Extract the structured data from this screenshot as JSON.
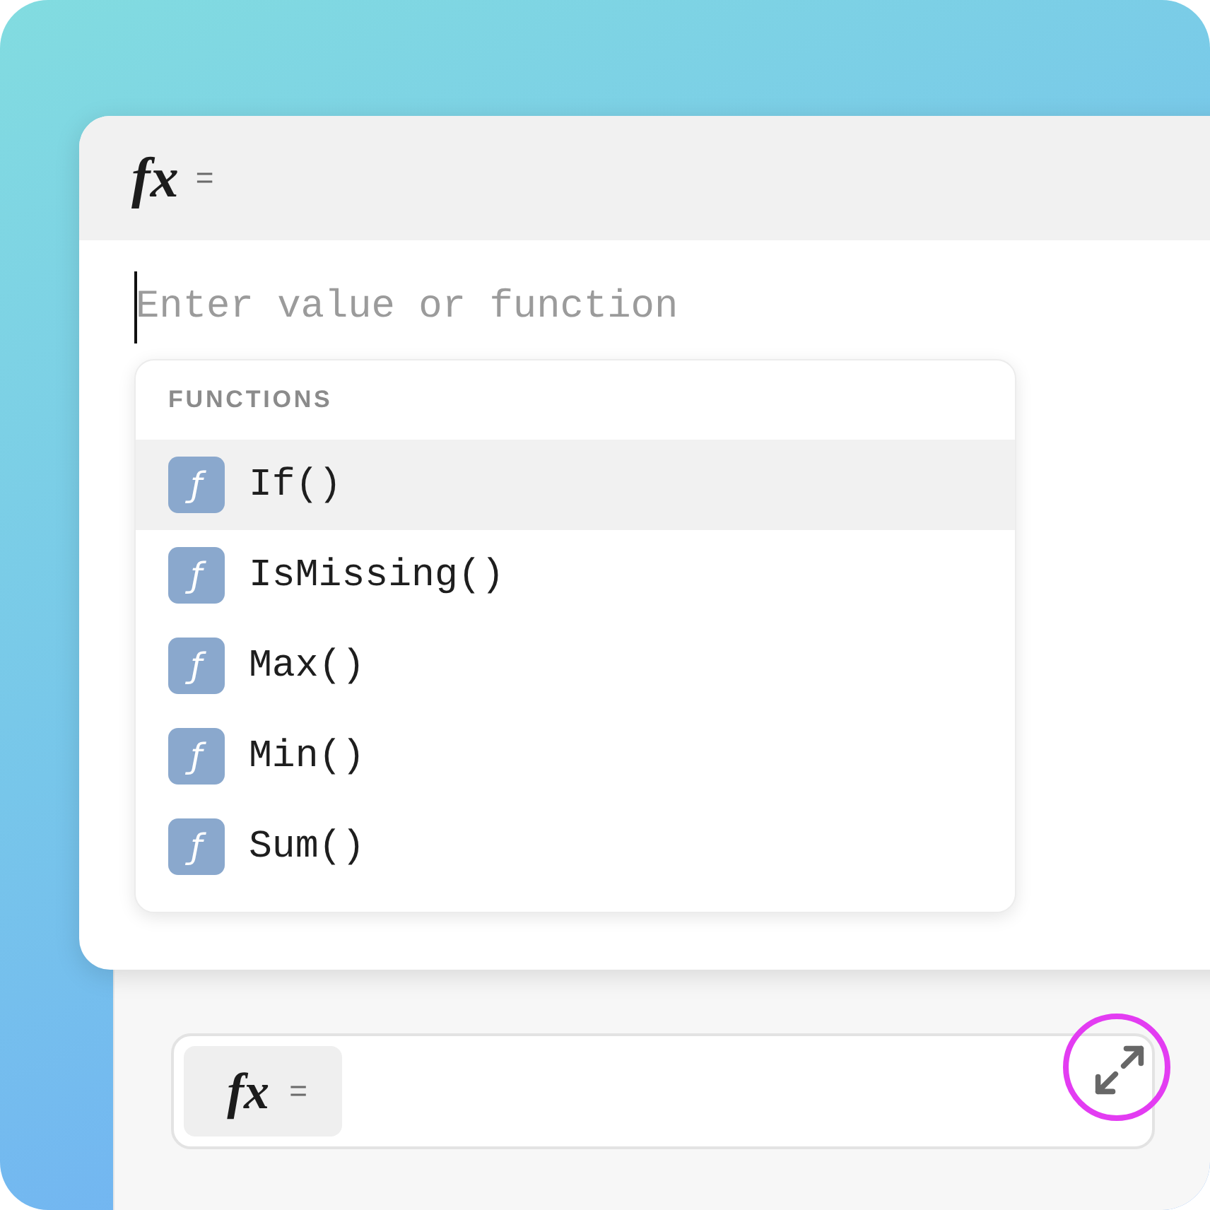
{
  "popover": {
    "header": {
      "symbol": "fx",
      "operator": "="
    },
    "input": {
      "placeholder": "Enter value or function",
      "focused": true
    },
    "dropdown": {
      "heading": "FUNCTIONS",
      "items": [
        {
          "icon": "ƒ",
          "label": "If()",
          "selected": true
        },
        {
          "icon": "ƒ",
          "label": "IsMissing()",
          "selected": false
        },
        {
          "icon": "ƒ",
          "label": "Max()",
          "selected": false
        },
        {
          "icon": "ƒ",
          "label": "Min()",
          "selected": false
        },
        {
          "icon": "ƒ",
          "label": "Sum()",
          "selected": false
        }
      ]
    }
  },
  "formula_bar": {
    "prefix": {
      "symbol": "fx",
      "operator": "="
    },
    "expand_button": {
      "highlighted": true
    }
  }
}
